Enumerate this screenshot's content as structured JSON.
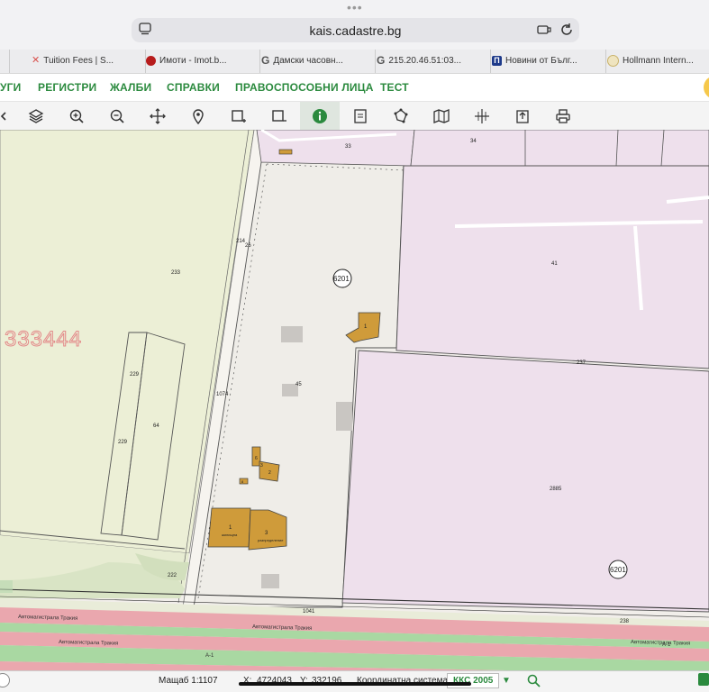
{
  "browser": {
    "url": "kais.cadastre.bg",
    "tabs": [
      {
        "label": "Tuition Fees | S...",
        "icon": "close-x-icon",
        "color": "#d9534f"
      },
      {
        "label": "Имоти - Imot.b...",
        "icon": "red-dot-icon",
        "color": "#b71c1c"
      },
      {
        "label": "Дамски часовн...",
        "icon": "google-g-icon",
        "color": "#555555"
      },
      {
        "label": "215.20.46.51:03...",
        "icon": "google-g-icon",
        "color": "#555555"
      },
      {
        "label": "Новини от Бълг...",
        "icon": "news-p-icon",
        "color": "#1e3a8a"
      },
      {
        "label": "Hollmann Intern...",
        "icon": "hollmann-icon",
        "color": "#c9b26b"
      }
    ]
  },
  "nav": {
    "items": [
      "УГИ",
      "РЕГИСТРИ",
      "ЖАЛБИ",
      "СПРАВКИ",
      "ПРАВОСПОСОБНИ ЛИЦА",
      "ТЕСТ"
    ]
  },
  "toolbar": {
    "icons": [
      "back-icon",
      "layers-icon",
      "zoom-in-icon",
      "zoom-out-icon",
      "pan-icon",
      "location-pin-icon",
      "select-rect-plus-icon",
      "select-rect-minus-icon",
      "info-icon",
      "document-icon",
      "polygon-icon",
      "map-icon",
      "crosshair-icon",
      "export-icon",
      "print-icon"
    ],
    "active": "info-icon"
  },
  "map": {
    "labels": {
      "big_number": "333444",
      "p33": "33",
      "p34": "34",
      "p214": "214",
      "p26": "26",
      "p233": "233",
      "p6201a": "6201",
      "p6201b": "6201",
      "p41": "41",
      "p1": "1",
      "p237": "237",
      "p229a": "229",
      "p64": "64",
      "p229b": "229",
      "p1074": "1074",
      "p45": "45",
      "p2885": "2885",
      "p2": "2",
      "p3": "3",
      "p3b": "3",
      "p1c": "1",
      "p222": "222",
      "p1041": "1041",
      "p238": "238",
      "p6": "6",
      "p8": "8",
      "house1": "1",
      "house1_sub": "жилищна",
      "house3": "3",
      "house3_sub": "разпределение",
      "road1": "Автомагистрала Тракия",
      "road2": "Автомагистрала Тракия",
      "road3": "Автомагистрала Тракия",
      "road4": "Автомагистрала Тракия",
      "a1": "А-1",
      "a1b": "А-1"
    },
    "colors": {
      "green_area": "#ecefd6",
      "pink_area": "#eee0ec",
      "road_red": "#eaa7ae",
      "road_green": "#a9d8a2",
      "building": "#cf9b3a"
    }
  },
  "status": {
    "scale_label": "Мащаб 1:",
    "scale_value": "1107",
    "x_label": "X:",
    "x_value": "4724043",
    "y_label": "Y:",
    "y_value": "332196",
    "crs_label": "Координатна система:",
    "crs_value": "ККС 2005"
  }
}
